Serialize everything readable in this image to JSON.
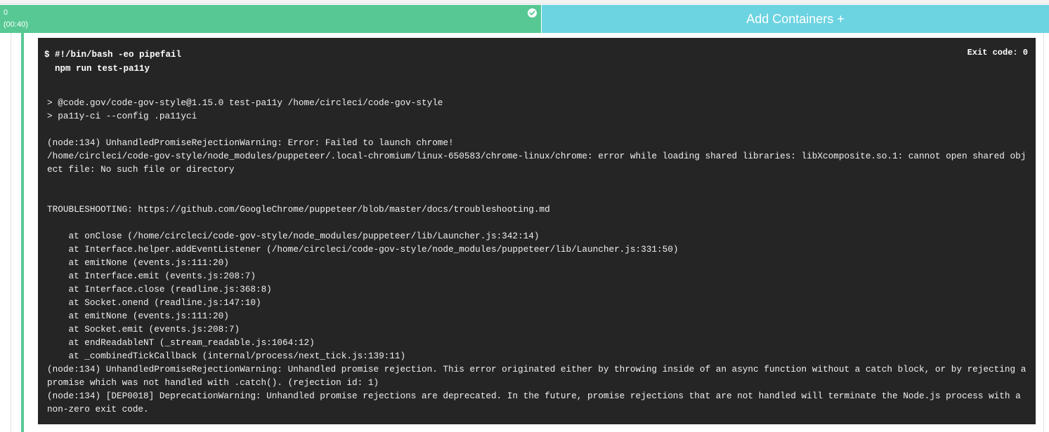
{
  "container_tab": {
    "index": "0",
    "duration": "(00:40)",
    "status_icon": "check-circle-icon",
    "color": "#57c894"
  },
  "add_containers": {
    "label": "Add Containers +",
    "color": "#6cd3e1"
  },
  "step": {
    "command_lines": [
      "$ #!/bin/bash -eo pipefail",
      "  npm run test-pa11y"
    ],
    "exit_code": "Exit code: 0"
  },
  "output_lines": [
    "> @code.gov/code-gov-style@1.15.0 test-pa11y /home/circleci/code-gov-style",
    "> pa11y-ci --config .pa11yci",
    "",
    "(node:134) UnhandledPromiseRejectionWarning: Error: Failed to launch chrome!",
    "/home/circleci/code-gov-style/node_modules/puppeteer/.local-chromium/linux-650583/chrome-linux/chrome: error while loading shared libraries: libXcomposite.so.1: cannot open shared object file: No such file or directory",
    "",
    "",
    "TROUBLESHOOTING: https://github.com/GoogleChrome/puppeteer/blob/master/docs/troubleshooting.md",
    "",
    "    at onClose (/home/circleci/code-gov-style/node_modules/puppeteer/lib/Launcher.js:342:14)",
    "    at Interface.helper.addEventListener (/home/circleci/code-gov-style/node_modules/puppeteer/lib/Launcher.js:331:50)",
    "    at emitNone (events.js:111:20)",
    "    at Interface.emit (events.js:208:7)",
    "    at Interface.close (readline.js:368:8)",
    "    at Socket.onend (readline.js:147:10)",
    "    at emitNone (events.js:111:20)",
    "    at Socket.emit (events.js:208:7)",
    "    at endReadableNT (_stream_readable.js:1064:12)",
    "    at _combinedTickCallback (internal/process/next_tick.js:139:11)",
    "(node:134) UnhandledPromiseRejectionWarning: Unhandled promise rejection. This error originated either by throwing inside of an async function without a catch block, or by rejecting a promise which was not handled with .catch(). (rejection id: 1)",
    "(node:134) [DEP0018] DeprecationWarning: Unhandled promise rejections are deprecated. In the future, promise rejections that are not handled will terminate the Node.js process with a non-zero exit code."
  ]
}
